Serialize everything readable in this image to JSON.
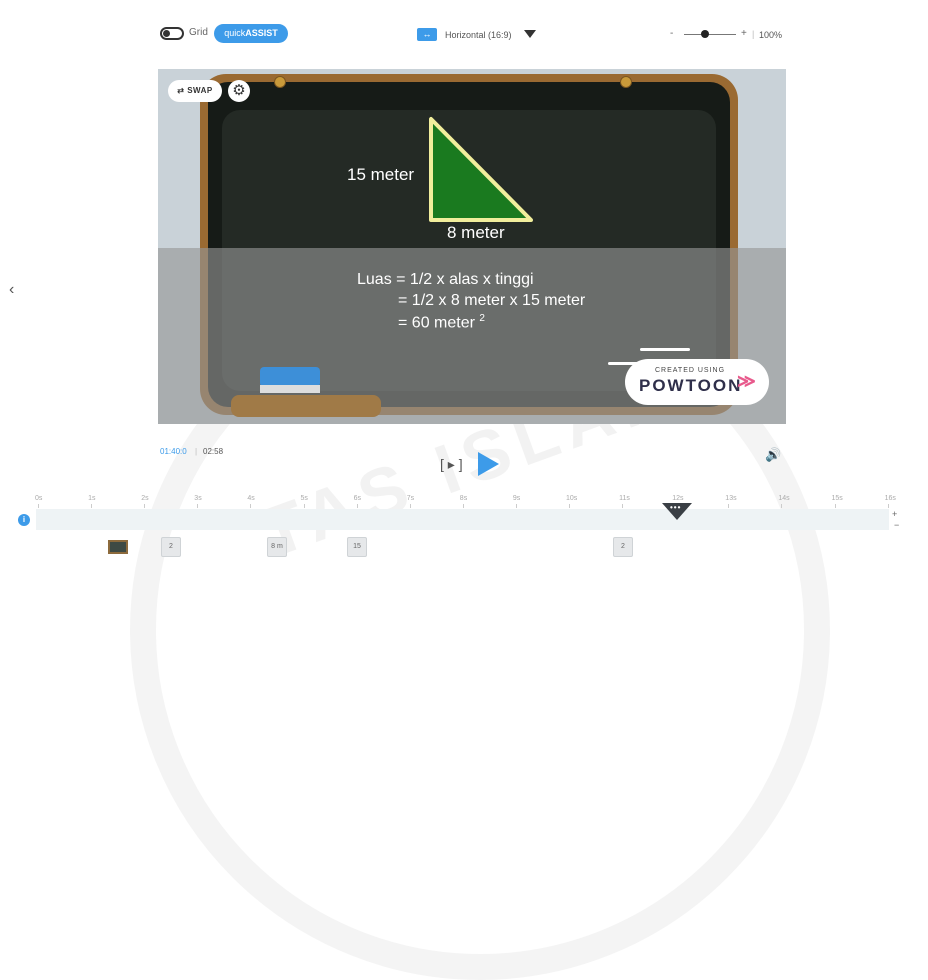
{
  "toolbar": {
    "grid_label": "Grid",
    "quick_assist_prefix": "quick",
    "quick_assist_suffix": "ASSIST",
    "aspect_label": "Horizontal (16:9)",
    "aspect_icon": "↔",
    "zoom_minus": "-",
    "zoom_plus": "+",
    "zoom_value": "100%",
    "zoom_level": 0.4
  },
  "stage": {
    "swap_label": "SWAP",
    "swap_icon": "⇄",
    "settings_icon": "⚙",
    "label_height": "15 meter",
    "label_base": "8 meter",
    "formula_line1": "Luas = 1/2 x alas x tinggi",
    "formula_line2": "= 1/2 x 8 meter x 15 meter",
    "formula_line3": "= 60 meter",
    "formula_exponent": "2",
    "badge_small": "CREATED USING",
    "badge_big": "POWTOON",
    "badge_mark": "≫"
  },
  "nav": {
    "prev_icon": "‹"
  },
  "playback": {
    "current_time": "01:40:0",
    "separator": "|",
    "total_time": "02:58",
    "bracket_play": "[ ▸ ]",
    "volume_icon": "🔊"
  },
  "timeline": {
    "ticks": [
      "0s",
      "1s",
      "2s",
      "3s",
      "4s",
      "5s",
      "6s",
      "7s",
      "8s",
      "9s",
      "10s",
      "11s",
      "12s",
      "13s",
      "14s",
      "15s",
      "16s"
    ],
    "info_label": "i",
    "playhead_dots": "•••",
    "plus": "+",
    "minus": "−",
    "chips": [
      {
        "label": "2"
      },
      {
        "label": "8 m"
      },
      {
        "label": "15"
      },
      {
        "label": "2"
      }
    ]
  },
  "colors": {
    "accent": "#3d9be9",
    "triangle_fill": "#1a7a1f",
    "triangle_stroke": "#f1ee9c"
  }
}
